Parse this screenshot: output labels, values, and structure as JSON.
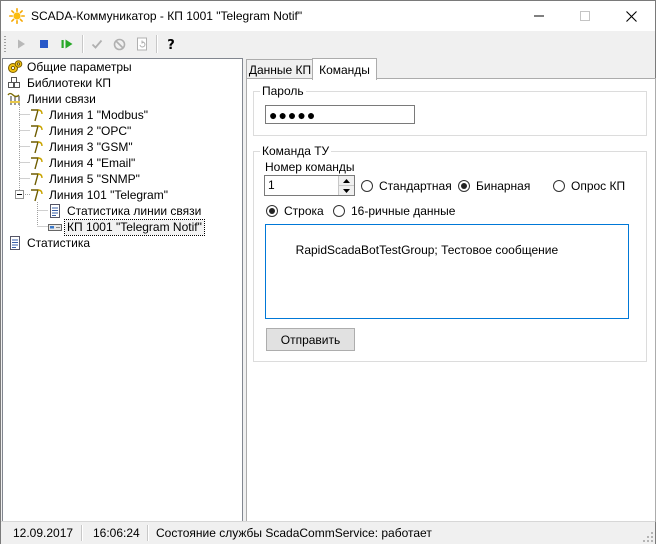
{
  "window": {
    "title": "SCADA-Коммуникатор - КП 1001 \"Telegram Notif\""
  },
  "toolbar": {
    "buttons": [
      {
        "icon": "play-icon"
      },
      {
        "icon": "stop-icon"
      },
      {
        "icon": "restart-icon"
      },
      {
        "icon": "check-icon"
      },
      {
        "icon": "cancel-icon"
      },
      {
        "icon": "refresh-icon"
      },
      {
        "icon": "help-icon"
      }
    ]
  },
  "tree": {
    "items": [
      {
        "label": "Общие параметры",
        "icon": "gears-icon"
      },
      {
        "label": "Библиотеки КП",
        "icon": "libraries-icon"
      },
      {
        "label": "Линии связи",
        "icon": "comm-lines-icon"
      },
      {
        "label": "Линия 1 \"Modbus\"",
        "icon": "comm-line-icon"
      },
      {
        "label": "Линия 2 \"OPC\"",
        "icon": "comm-line-icon"
      },
      {
        "label": "Линия 3 \"GSM\"",
        "icon": "comm-line-icon"
      },
      {
        "label": "Линия 4 \"Email\"",
        "icon": "comm-line-icon"
      },
      {
        "label": "Линия 5 \"SNMP\"",
        "icon": "comm-line-icon"
      },
      {
        "label": "Линия 101 \"Telegram\"",
        "icon": "comm-line-icon"
      },
      {
        "label": "Статистика линии связи",
        "icon": "document-icon"
      },
      {
        "label": "КП 1001 \"Telegram Notif\"",
        "icon": "device-icon"
      },
      {
        "label": "Статистика",
        "icon": "document-icon"
      }
    ]
  },
  "tabs": [
    {
      "label": "Данные КП"
    },
    {
      "label": "Команды"
    }
  ],
  "password": {
    "title": "Пароль",
    "value": "●●●●●"
  },
  "command": {
    "title": "Команда ТУ",
    "number_label": "Номер команды",
    "number_value": "1",
    "type_options": [
      {
        "label": "Стандартная",
        "checked": false
      },
      {
        "label": "Бинарная",
        "checked": true
      },
      {
        "label": "Опрос КП",
        "checked": false
      }
    ],
    "format_options": [
      {
        "label": "Строка",
        "checked": true
      },
      {
        "label": "16-ричные данные",
        "checked": false
      }
    ],
    "text": "RapidScadaBotTestGroup; Тестовое сообщение",
    "send_label": "Отправить"
  },
  "status": {
    "date": "12.09.2017",
    "time": "16:06:24",
    "message": "Состояние службы ScadaCommService: работает"
  },
  "colors": {
    "accent": "#0078d7",
    "play": "#28a828",
    "stop": "#2858c8",
    "title_icon": "#f6a800"
  }
}
